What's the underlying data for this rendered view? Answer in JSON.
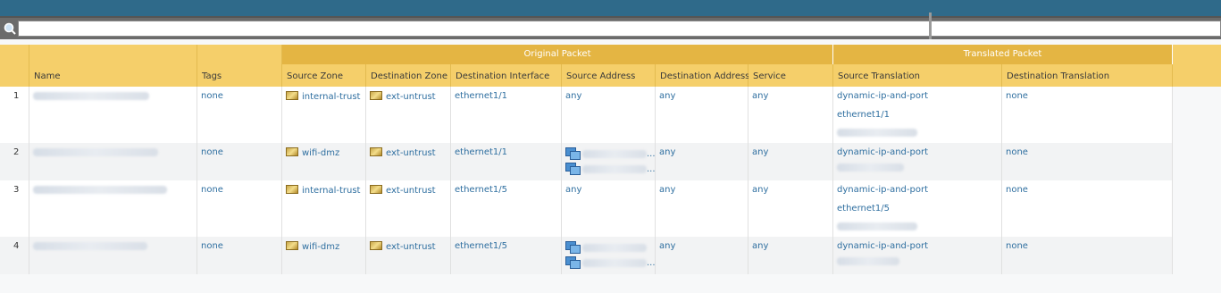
{
  "search": {
    "placeholder": "",
    "value": ""
  },
  "header": {
    "groups": {
      "original": "Original Packet",
      "translated": "Translated Packet"
    },
    "columns": {
      "name": "Name",
      "tags": "Tags",
      "source_zone": "Source Zone",
      "destination_zone": "Destination Zone",
      "destination_interface": "Destination Interface",
      "source_address": "Source Address",
      "destination_address": "Destination Address",
      "service": "Service",
      "source_translation": "Source Translation",
      "destination_translation": "Destination Translation"
    }
  },
  "rows": [
    {
      "num": "1",
      "tags": "none",
      "source_zone": "internal-trust",
      "destination_zone": "ext-untrust",
      "destination_interface": "ethernet1/1",
      "source_address": "any",
      "destination_address": "any",
      "service": "any",
      "source_translation_1": "dynamic-ip-and-port",
      "source_translation_2": "ethernet1/1",
      "destination_translation": "none"
    },
    {
      "num": "2",
      "tags": "none",
      "source_zone": "wifi-dmz",
      "destination_zone": "ext-untrust",
      "destination_interface": "ethernet1/1",
      "source_address_more": "...",
      "destination_address": "any",
      "service": "any",
      "source_translation_1": "dynamic-ip-and-port",
      "destination_translation": "none"
    },
    {
      "num": "3",
      "tags": "none",
      "source_zone": "internal-trust",
      "destination_zone": "ext-untrust",
      "destination_interface": "ethernet1/5",
      "source_address": "any",
      "destination_address": "any",
      "service": "any",
      "source_translation_1": "dynamic-ip-and-port",
      "source_translation_2": "ethernet1/5",
      "destination_translation": "none"
    },
    {
      "num": "4",
      "tags": "none",
      "source_zone": "wifi-dmz",
      "destination_zone": "ext-untrust",
      "destination_interface": "ethernet1/5",
      "source_address_more": "...",
      "destination_address": "any",
      "service": "any",
      "source_translation_1": "dynamic-ip-and-port",
      "destination_translation": "none"
    }
  ],
  "icons": {
    "search": "search-icon",
    "zone": "zone-icon",
    "address": "address-object-icon"
  },
  "colors": {
    "topbar": "#2f6a8a",
    "header": "#f5cf6a",
    "header_group": "#e4b543",
    "link": "#2f6fa0"
  }
}
